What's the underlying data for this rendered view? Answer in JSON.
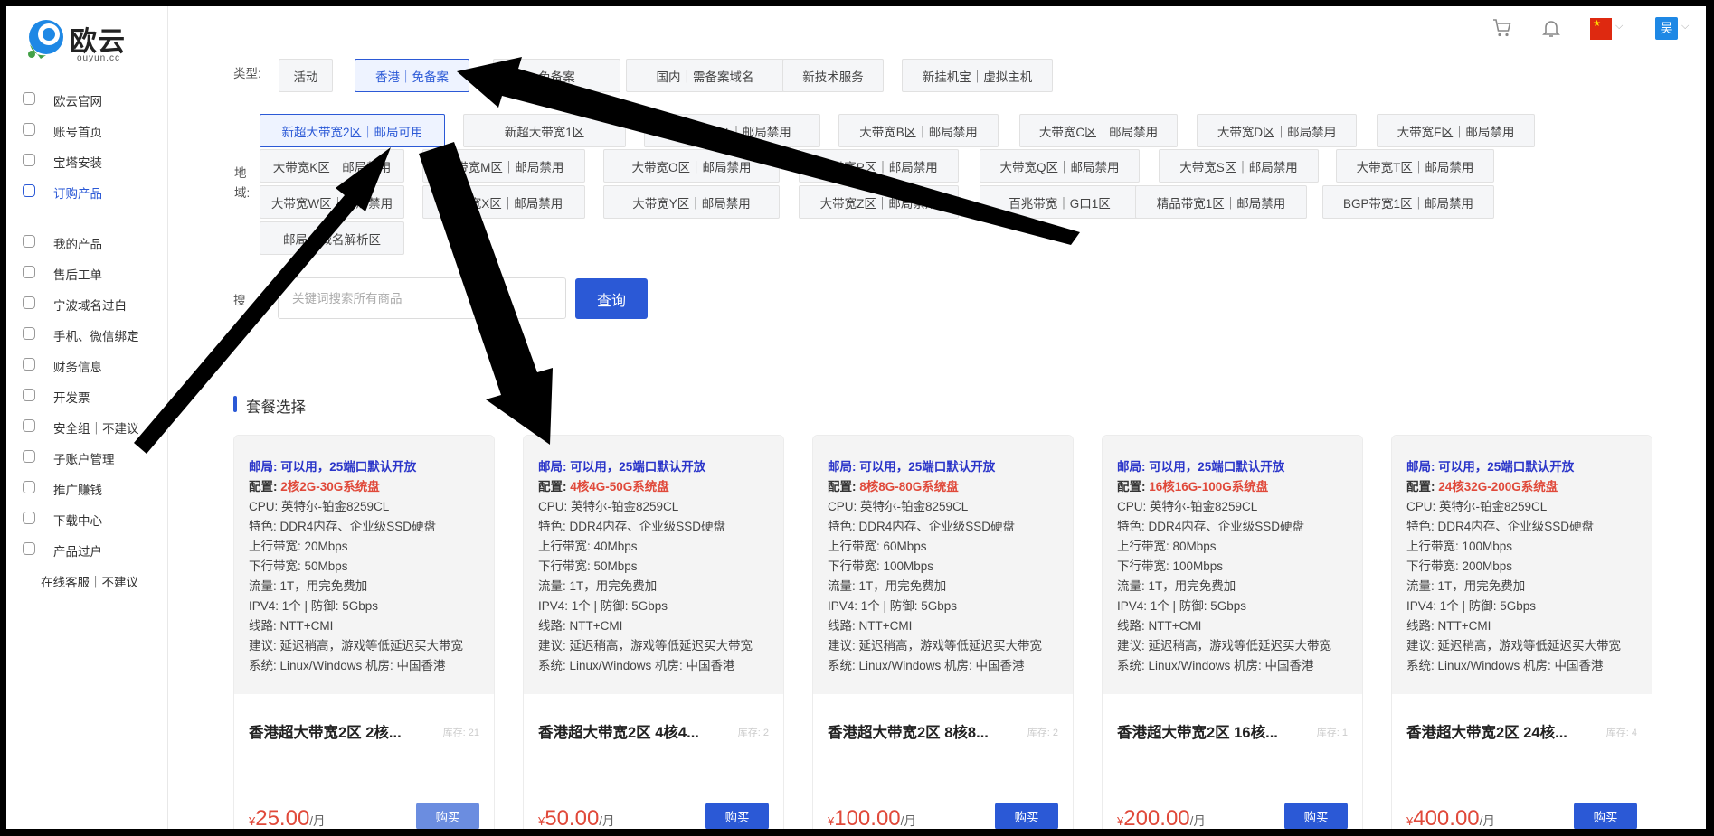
{
  "logo": {
    "text": "欧云",
    "sub": "ouyun.cc"
  },
  "sidebar": {
    "items": [
      {
        "label": "欧云官网",
        "icon": "home-icon"
      },
      {
        "label": "账号首页",
        "icon": "user-icon"
      },
      {
        "label": "宝塔安装",
        "icon": "pagoda-icon"
      },
      {
        "label": "订购产品",
        "icon": "cart-icon",
        "active": true
      },
      {
        "label": "我的产品",
        "icon": "list-icon"
      },
      {
        "label": "售后工单",
        "icon": "headset-icon"
      },
      {
        "label": "宁波域名过白",
        "icon": "domain-icon"
      },
      {
        "label": "手机、微信绑定",
        "icon": "phone-icon"
      },
      {
        "label": "财务信息",
        "icon": "yen-icon"
      },
      {
        "label": "开发票",
        "icon": "invoice-icon"
      },
      {
        "label": "安全组｜不建议",
        "icon": "lock-icon"
      },
      {
        "label": "子账户管理",
        "icon": "subaccount-icon"
      },
      {
        "label": "推广赚钱",
        "icon": "coin-icon"
      },
      {
        "label": "下载中心",
        "icon": "tag-icon"
      },
      {
        "label": "产品过户",
        "icon": "transfer-icon"
      },
      {
        "label": "在线客服｜不建议",
        "icon": ""
      }
    ]
  },
  "topbar": {
    "avatar_text": "吴",
    "flag": "china-flag-icon"
  },
  "filters": {
    "type_label": "类型:",
    "types": [
      "活动",
      "香港｜免备案",
      "免备案",
      "国内｜需备案域名",
      "新技术服务",
      "新挂机宝｜虚拟主机"
    ],
    "region_label_1": "地",
    "region_label_2": "域:",
    "regions": [
      "新超大带宽2区｜邮局可用",
      "新超大带宽1区",
      "大带宽A区｜邮局禁用",
      "大带宽B区｜邮局禁用",
      "大带宽C区｜邮局禁用",
      "大带宽D区｜邮局禁用",
      "大带宽F区｜邮局禁用",
      "大带宽K区｜邮局禁用",
      "大带宽M区｜邮局禁用",
      "大带宽O区｜邮局禁用",
      "大带宽P区｜邮局禁用",
      "大带宽Q区｜邮局禁用",
      "大带宽S区｜邮局禁用",
      "大带宽T区｜邮局禁用",
      "大带宽W区｜邮局禁用",
      "大带宽X区｜邮局禁用",
      "大带宽Y区｜邮局禁用",
      "大带宽Z区｜邮局禁用",
      "百兆带宽｜G口1区",
      "精品带宽1区｜邮局禁用",
      "BGP带宽1区｜邮局禁用",
      "邮局｜域名解析区"
    ]
  },
  "search": {
    "label": "搜",
    "placeholder": "关键词搜索所有商品",
    "button": "查询"
  },
  "section_title": "套餐选择",
  "common": {
    "mail": "邮局: 可以用，25端口默认开放",
    "config_prefix": "配置: ",
    "cpu": "CPU: 英特尔-铂金8259CL",
    "feature": "特色: DDR4内存、企业级SSD硬盘",
    "traffic": "流量: 1T，用完免费加",
    "ipv4": "IPV4: 1个 | 防御: 5Gbps",
    "line": "线路: NTT+CMI",
    "advice": "建议: 延迟稍高，游戏等低延迟买大带宽",
    "system": "系统: Linux/Windows 机房: 中国香港",
    "currency": "¥",
    "per": "/月",
    "buy": "购买"
  },
  "cards": [
    {
      "config": "2核2G-30G系统盘",
      "up": "上行带宽: 20Mbps",
      "down": "下行带宽: 50Mbps",
      "title": "香港超大带宽2区 2核...",
      "stock": "库存: 21",
      "price": "25.00"
    },
    {
      "config": "4核4G-50G系统盘",
      "up": "上行带宽: 40Mbps",
      "down": "下行带宽: 50Mbps",
      "title": "香港超大带宽2区 4核4...",
      "stock": "库存: 2",
      "price": "50.00"
    },
    {
      "config": "8核8G-80G系统盘",
      "up": "上行带宽: 60Mbps",
      "down": "下行带宽: 100Mbps",
      "title": "香港超大带宽2区 8核8...",
      "stock": "库存: 2",
      "price": "100.00"
    },
    {
      "config": "16核16G-100G系统盘",
      "up": "上行带宽: 80Mbps",
      "down": "下行带宽: 100Mbps",
      "title": "香港超大带宽2区 16核...",
      "stock": "库存: 1",
      "price": "200.00"
    },
    {
      "config": "24核32G-200G系统盘",
      "up": "上行带宽: 100Mbps",
      "down": "下行带宽: 200Mbps",
      "title": "香港超大带宽2区 24核...",
      "stock": "库存: 4",
      "price": "400.00"
    }
  ],
  "colors": {
    "accent": "#2b59d6",
    "price": "#e0493a",
    "mail": "#2b35c9"
  }
}
